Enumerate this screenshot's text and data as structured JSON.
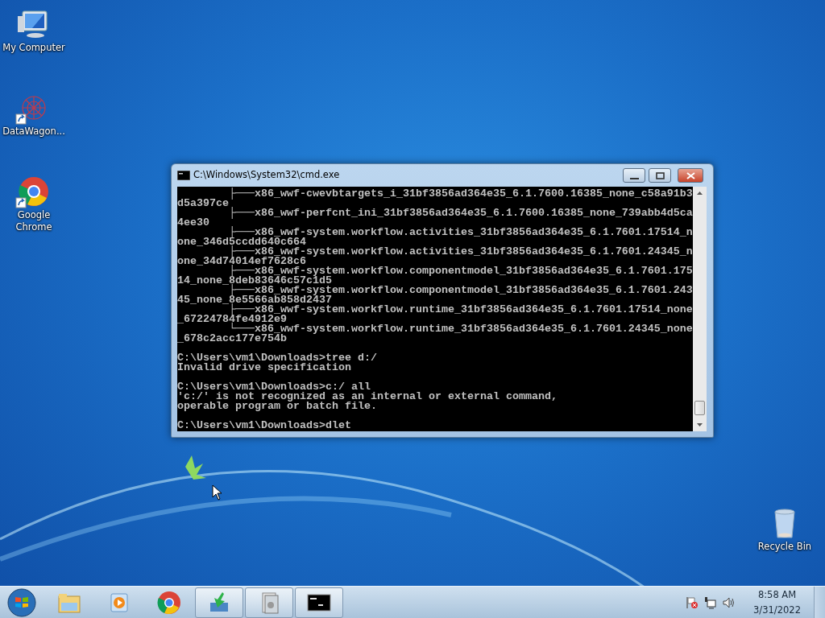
{
  "desktop_icons": [
    {
      "label": "My Computer",
      "kind": "computer",
      "shortcut": false
    },
    {
      "label": "DataWagon...",
      "kind": "datawagon",
      "shortcut": true
    },
    {
      "label": "Google Chrome",
      "kind": "chrome",
      "shortcut": true
    },
    {
      "label": "Recycle Bin",
      "kind": "recycle",
      "shortcut": false
    }
  ],
  "window": {
    "title": "C:\\Windows\\System32\\cmd.exe",
    "console_blocks": [
      [
        "        ├───x86_wwf-cwevbtargets_i_31bf3856ad364e35_6.1.7600.16385_none_c58a91b3",
        "d5a397ce",
        "        ├───x86_wwf-perfcnt_ini_31bf3856ad364e35_6.1.7600.16385_none_739abb4d5ca",
        "4ee30",
        "        ├───x86_wwf-system.workflow.activities_31bf3856ad364e35_6.1.7601.17514_n",
        "one_346d5ccdd640c664",
        "        ├───x86_wwf-system.workflow.activities_31bf3856ad364e35_6.1.7601.24345_n",
        "one_34d74014ef7628c6",
        "        ├───x86_wwf-system.workflow.componentmodel_31bf3856ad364e35_6.1.7601.175",
        "14_none_8deb83646c57c1d5",
        "        ├───x86_wwf-system.workflow.componentmodel_31bf3856ad364e35_6.1.7601.243",
        "45_none_8e5566ab858d2437",
        "        ├───x86_wwf-system.workflow.runtime_31bf3856ad364e35_6.1.7601.17514_none",
        "_67224784fe4912e9",
        "        └───x86_wwf-system.workflow.runtime_31bf3856ad364e35_6.1.7601.24345_none",
        "_678c2acc177e754b"
      ],
      [
        "C:\\Users\\vm1\\Downloads>tree d:/",
        "Invalid drive specification"
      ],
      [
        "C:\\Users\\vm1\\Downloads>c:/ all",
        "'c:/' is not recognized as an internal or external command,",
        "operable program or batch file."
      ],
      [
        "C:\\Users\\vm1\\Downloads>dlet"
      ]
    ]
  },
  "taskbar": {
    "items": [
      {
        "kind": "folder",
        "running": false
      },
      {
        "kind": "media",
        "running": false
      },
      {
        "kind": "chrome",
        "running": false
      },
      {
        "kind": "installer",
        "running": true
      },
      {
        "kind": "app",
        "running": true
      },
      {
        "kind": "console",
        "running": true
      }
    ],
    "tray_icons": [
      {
        "kind": "flag"
      },
      {
        "kind": "network"
      },
      {
        "kind": "volume"
      }
    ],
    "clock": {
      "time": "8:58 AM",
      "date": "3/31/2022"
    }
  }
}
